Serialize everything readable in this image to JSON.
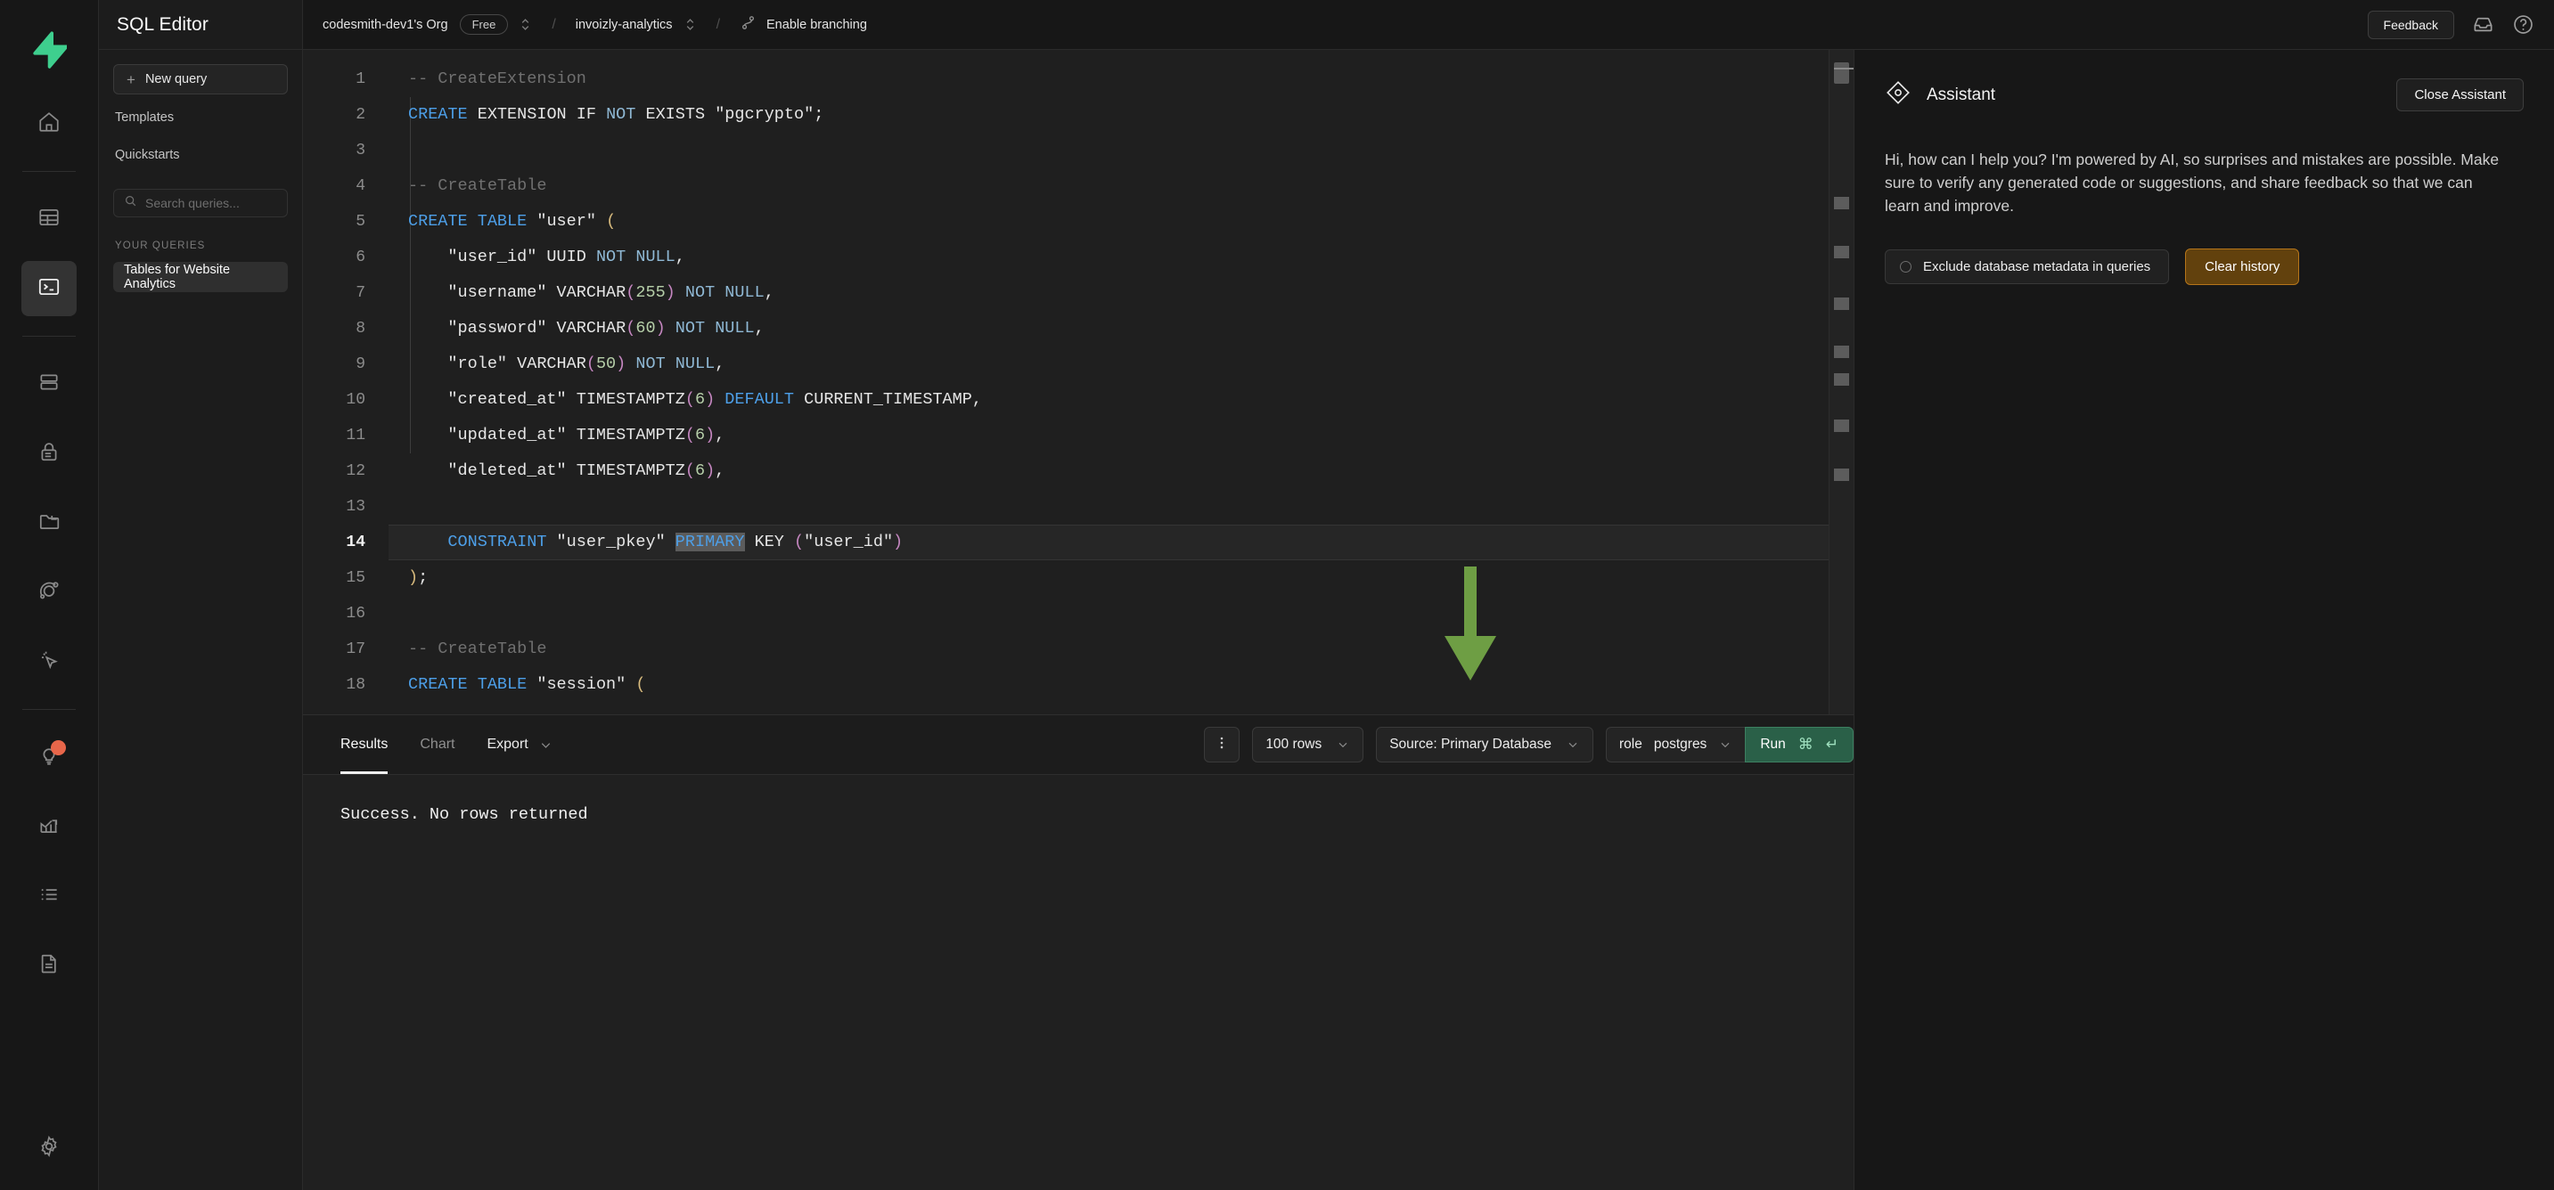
{
  "rail": {
    "logo": "supabase-logo",
    "items": [
      {
        "name": "home",
        "icon": "home-icon",
        "active": false
      },
      {
        "name": "table-editor",
        "icon": "table-icon",
        "active": false
      },
      {
        "name": "sql-editor",
        "icon": "terminal-icon",
        "active": true
      },
      {
        "name": "database",
        "icon": "database-icon",
        "active": false
      },
      {
        "name": "authentication",
        "icon": "lock-icon",
        "active": false
      },
      {
        "name": "storage",
        "icon": "folder-icon",
        "active": false
      },
      {
        "name": "realtime",
        "icon": "realtime-icon",
        "active": false
      },
      {
        "name": "edge-functions",
        "icon": "cursor-click-icon",
        "active": false
      },
      {
        "name": "advisors",
        "icon": "lightbulb-icon",
        "active": false,
        "badge": true
      },
      {
        "name": "reports",
        "icon": "chart-up-icon",
        "active": false
      },
      {
        "name": "logs",
        "icon": "list-icon",
        "active": false
      },
      {
        "name": "api-docs",
        "icon": "document-icon",
        "active": false
      },
      {
        "name": "project-settings",
        "icon": "gear-icon",
        "active": false
      }
    ]
  },
  "sidebar": {
    "title": "SQL Editor",
    "new_query_label": "New query",
    "nav": [
      {
        "label": "Templates"
      },
      {
        "label": "Quickstarts"
      }
    ],
    "search": {
      "placeholder": "Search queries...",
      "value": "",
      "icon": "search-icon"
    },
    "section_label": "YOUR QUERIES",
    "queries": [
      {
        "label": "Tables for Website Analytics",
        "selected": true
      }
    ]
  },
  "topbar": {
    "org": "codesmith-dev1's Org",
    "plan": "Free",
    "project": "invoizly-analytics",
    "branching": "Enable branching",
    "branching_icon": "git-branch-icon",
    "feedback": "Feedback",
    "inbox_icon": "inbox-icon",
    "help_icon": "help-circle-icon",
    "separator": "/"
  },
  "editor": {
    "active_line": 14,
    "lines": [
      {
        "n": 1,
        "tokens": [
          {
            "t": "-- CreateExtension",
            "c": "cmt"
          }
        ]
      },
      {
        "n": 2,
        "tokens": [
          {
            "t": "CREATE",
            "c": "kw"
          },
          {
            "t": " EXTENSION IF ",
            "c": "typ"
          },
          {
            "t": "NOT",
            "c": "nn"
          },
          {
            "t": " EXISTS \"pgcrypto\";",
            "c": "typ"
          }
        ]
      },
      {
        "n": 3,
        "tokens": []
      },
      {
        "n": 4,
        "tokens": [
          {
            "t": "-- CreateTable",
            "c": "cmt"
          }
        ]
      },
      {
        "n": 5,
        "tokens": [
          {
            "t": "CREATE TABLE",
            "c": "kw"
          },
          {
            "t": " \"user\" ",
            "c": "typ"
          },
          {
            "t": "(",
            "c": "par2"
          }
        ]
      },
      {
        "n": 6,
        "tokens": [
          {
            "t": "    \"user_id\" UUID ",
            "c": "typ"
          },
          {
            "t": "NOT NULL",
            "c": "nn"
          },
          {
            "t": ",",
            "c": "typ"
          }
        ]
      },
      {
        "n": 7,
        "tokens": [
          {
            "t": "    \"username\" VARCHAR",
            "c": "typ"
          },
          {
            "t": "(",
            "c": "par"
          },
          {
            "t": "255",
            "c": "num"
          },
          {
            "t": ")",
            "c": "par"
          },
          {
            "t": " ",
            "c": "typ"
          },
          {
            "t": "NOT NULL",
            "c": "nn"
          },
          {
            "t": ",",
            "c": "typ"
          }
        ]
      },
      {
        "n": 8,
        "tokens": [
          {
            "t": "    \"password\" VARCHAR",
            "c": "typ"
          },
          {
            "t": "(",
            "c": "par"
          },
          {
            "t": "60",
            "c": "num"
          },
          {
            "t": ")",
            "c": "par"
          },
          {
            "t": " ",
            "c": "typ"
          },
          {
            "t": "NOT NULL",
            "c": "nn"
          },
          {
            "t": ",",
            "c": "typ"
          }
        ]
      },
      {
        "n": 9,
        "tokens": [
          {
            "t": "    \"role\" VARCHAR",
            "c": "typ"
          },
          {
            "t": "(",
            "c": "par"
          },
          {
            "t": "50",
            "c": "num"
          },
          {
            "t": ")",
            "c": "par"
          },
          {
            "t": " ",
            "c": "typ"
          },
          {
            "t": "NOT NULL",
            "c": "nn"
          },
          {
            "t": ",",
            "c": "typ"
          }
        ]
      },
      {
        "n": 10,
        "tokens": [
          {
            "t": "    \"created_at\" TIMESTAMPTZ",
            "c": "typ"
          },
          {
            "t": "(",
            "c": "par"
          },
          {
            "t": "6",
            "c": "num"
          },
          {
            "t": ")",
            "c": "par"
          },
          {
            "t": " ",
            "c": "typ"
          },
          {
            "t": "DEFAULT",
            "c": "kw"
          },
          {
            "t": " CURRENT_TIMESTAMP,",
            "c": "typ"
          }
        ]
      },
      {
        "n": 11,
        "tokens": [
          {
            "t": "    \"updated_at\" TIMESTAMPTZ",
            "c": "typ"
          },
          {
            "t": "(",
            "c": "par"
          },
          {
            "t": "6",
            "c": "num"
          },
          {
            "t": ")",
            "c": "par"
          },
          {
            "t": ",",
            "c": "typ"
          }
        ]
      },
      {
        "n": 12,
        "tokens": [
          {
            "t": "    \"deleted_at\" TIMESTAMPTZ",
            "c": "typ"
          },
          {
            "t": "(",
            "c": "par"
          },
          {
            "t": "6",
            "c": "num"
          },
          {
            "t": ")",
            "c": "par"
          },
          {
            "t": ",",
            "c": "typ"
          }
        ]
      },
      {
        "n": 13,
        "tokens": []
      },
      {
        "n": 14,
        "tokens": [
          {
            "t": "    ",
            "c": "typ"
          },
          {
            "t": "CONSTRAINT",
            "c": "kw"
          },
          {
            "t": " \"user_pkey\" ",
            "c": "typ"
          },
          {
            "t": "PRIMARY",
            "c": "kw sel"
          },
          {
            "t": " KEY ",
            "c": "typ"
          },
          {
            "t": "(",
            "c": "par"
          },
          {
            "t": "\"user_id\"",
            "c": "typ"
          },
          {
            "t": ")",
            "c": "par"
          }
        ]
      },
      {
        "n": 15,
        "tokens": [
          {
            "t": ")",
            "c": "par2"
          },
          {
            "t": ";",
            "c": "typ"
          }
        ]
      },
      {
        "n": 16,
        "tokens": []
      },
      {
        "n": 17,
        "tokens": [
          {
            "t": "-- CreateTable",
            "c": "cmt"
          }
        ]
      },
      {
        "n": 18,
        "tokens": [
          {
            "t": "CREATE TABLE",
            "c": "kw"
          },
          {
            "t": " \"session\" ",
            "c": "typ"
          },
          {
            "t": "(",
            "c": "par2"
          }
        ]
      }
    ],
    "annotation_arrow": {
      "direction": "down",
      "color": "#6e9e44"
    }
  },
  "results_toolbar": {
    "tabs": [
      {
        "label": "Results",
        "active": true
      },
      {
        "label": "Chart",
        "active": false
      }
    ],
    "export_label": "Export",
    "kebab_icon": "more-vertical-icon",
    "rows_limit": "100 rows",
    "source": "Source: Primary Database",
    "role_prefix": "role",
    "role_value": "postgres",
    "run_label": "Run",
    "run_shortcut_cmd": "⌘",
    "run_shortcut_enter": "↵"
  },
  "results": {
    "message": "Success. No rows returned"
  },
  "assistant": {
    "icon": "assistant-diamond-icon",
    "title": "Assistant",
    "close_label": "Close Assistant",
    "message": "Hi, how can I help you? I'm powered by AI, so surprises and mistakes are possible. Make sure to verify any generated code or suggestions, and share feedback so that we can learn and improve.",
    "exclude_metadata_label": "Exclude database metadata in queries",
    "clear_history_label": "Clear history"
  },
  "colors": {
    "brand_green": "#3ecf8e",
    "run_button": "#2a6048",
    "arrow_annotation": "#6e9e44",
    "clear_history": "#62410d",
    "badge_dot": "#e8664a",
    "keyword": "#4d9fe8",
    "number": "#b5cea8",
    "comment": "#707070"
  }
}
